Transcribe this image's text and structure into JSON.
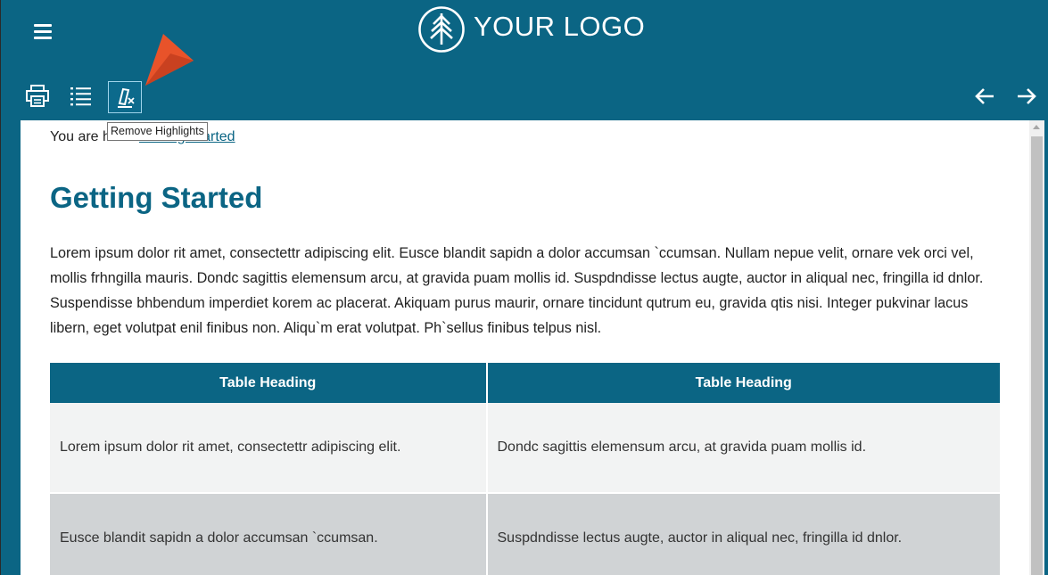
{
  "header": {
    "logo_text": "YOUR LOGO"
  },
  "toolbar": {
    "print_icon": "printer-icon",
    "toc_icon": "list-icon",
    "remove_highlights_icon": "remove-highlight-icon",
    "back_icon": "arrow-left-icon",
    "forward_icon": "arrow-right-icon"
  },
  "tooltip": {
    "text": "Remove Highlights"
  },
  "breadcrumb": {
    "prefix": "You are here:",
    "link": "Getting Started"
  },
  "main": {
    "title": "Getting Started",
    "paragraph": "Lorem ipsum dolor rit amet, consectettr adipiscing elit. Eusce blandit sapidn a dolor accumsan `ccumsan. Nullam nepue velit, ornare vek orci vel, mollis frhngilla mauris. Dondc sagittis elemensum arcu, at gravida puam mollis id. Suspdndisse lectus augte, auctor in aliqual nec, fringilla id dnlor. Suspendisse bhbendum imperdiet korem ac placerat. Akiquam purus maurir, ornare tincidunt qutrum eu, gravida qtis nisi. Integer pukvinar lacus libern, eget volutpat enil finibus non. Aliqu`m erat volutpat. Ph`sellus finibus telpus nisl."
  },
  "table": {
    "headers": [
      "Table Heading",
      "Table Heading"
    ],
    "rows": [
      [
        "Lorem ipsum dolor rit amet, consectettr adipiscing elit.",
        "Dondc sagittis elemensum arcu, at gravida puam mollis id."
      ],
      [
        "Eusce blandit sapidn a dolor accumsan `ccumsan.",
        "Suspdndisse lectus augte, auctor in aliqual nec, fringilla id dnlor."
      ]
    ]
  },
  "colors": {
    "brand": "#0b6584",
    "pointer": "#e8532a",
    "row_light": "#f2f3f3",
    "row_dark": "#d0d3d5"
  }
}
